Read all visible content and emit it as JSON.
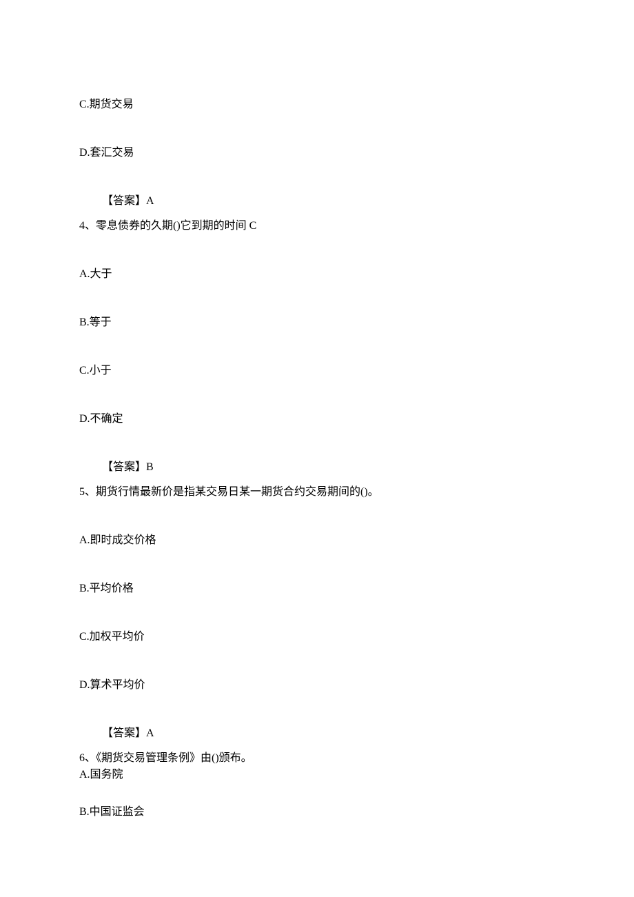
{
  "q3_continuation": {
    "option_c": "C.期货交易",
    "option_d": "D.套汇交易",
    "answer": "【答案】A"
  },
  "q4": {
    "stem": "4、零息债券的久期()它到期的时间 C",
    "option_a": "A.大于",
    "option_b": "B.等于",
    "option_c": "C.小于",
    "option_d": "D.不确定",
    "answer": "【答案】B"
  },
  "q5": {
    "stem": "5、期货行情最新价是指某交易日某一期货合约交易期间的()。",
    "option_a": "A.即时成交价格",
    "option_b": "B.平均价格",
    "option_c": "C.加权平均价",
    "option_d": "D.算术平均价",
    "answer": "【答案】A"
  },
  "q6": {
    "stem": "6、《期货交易管理条例》由()颁布。",
    "option_a": "A.国务院",
    "option_b": "B.中国证监会"
  }
}
